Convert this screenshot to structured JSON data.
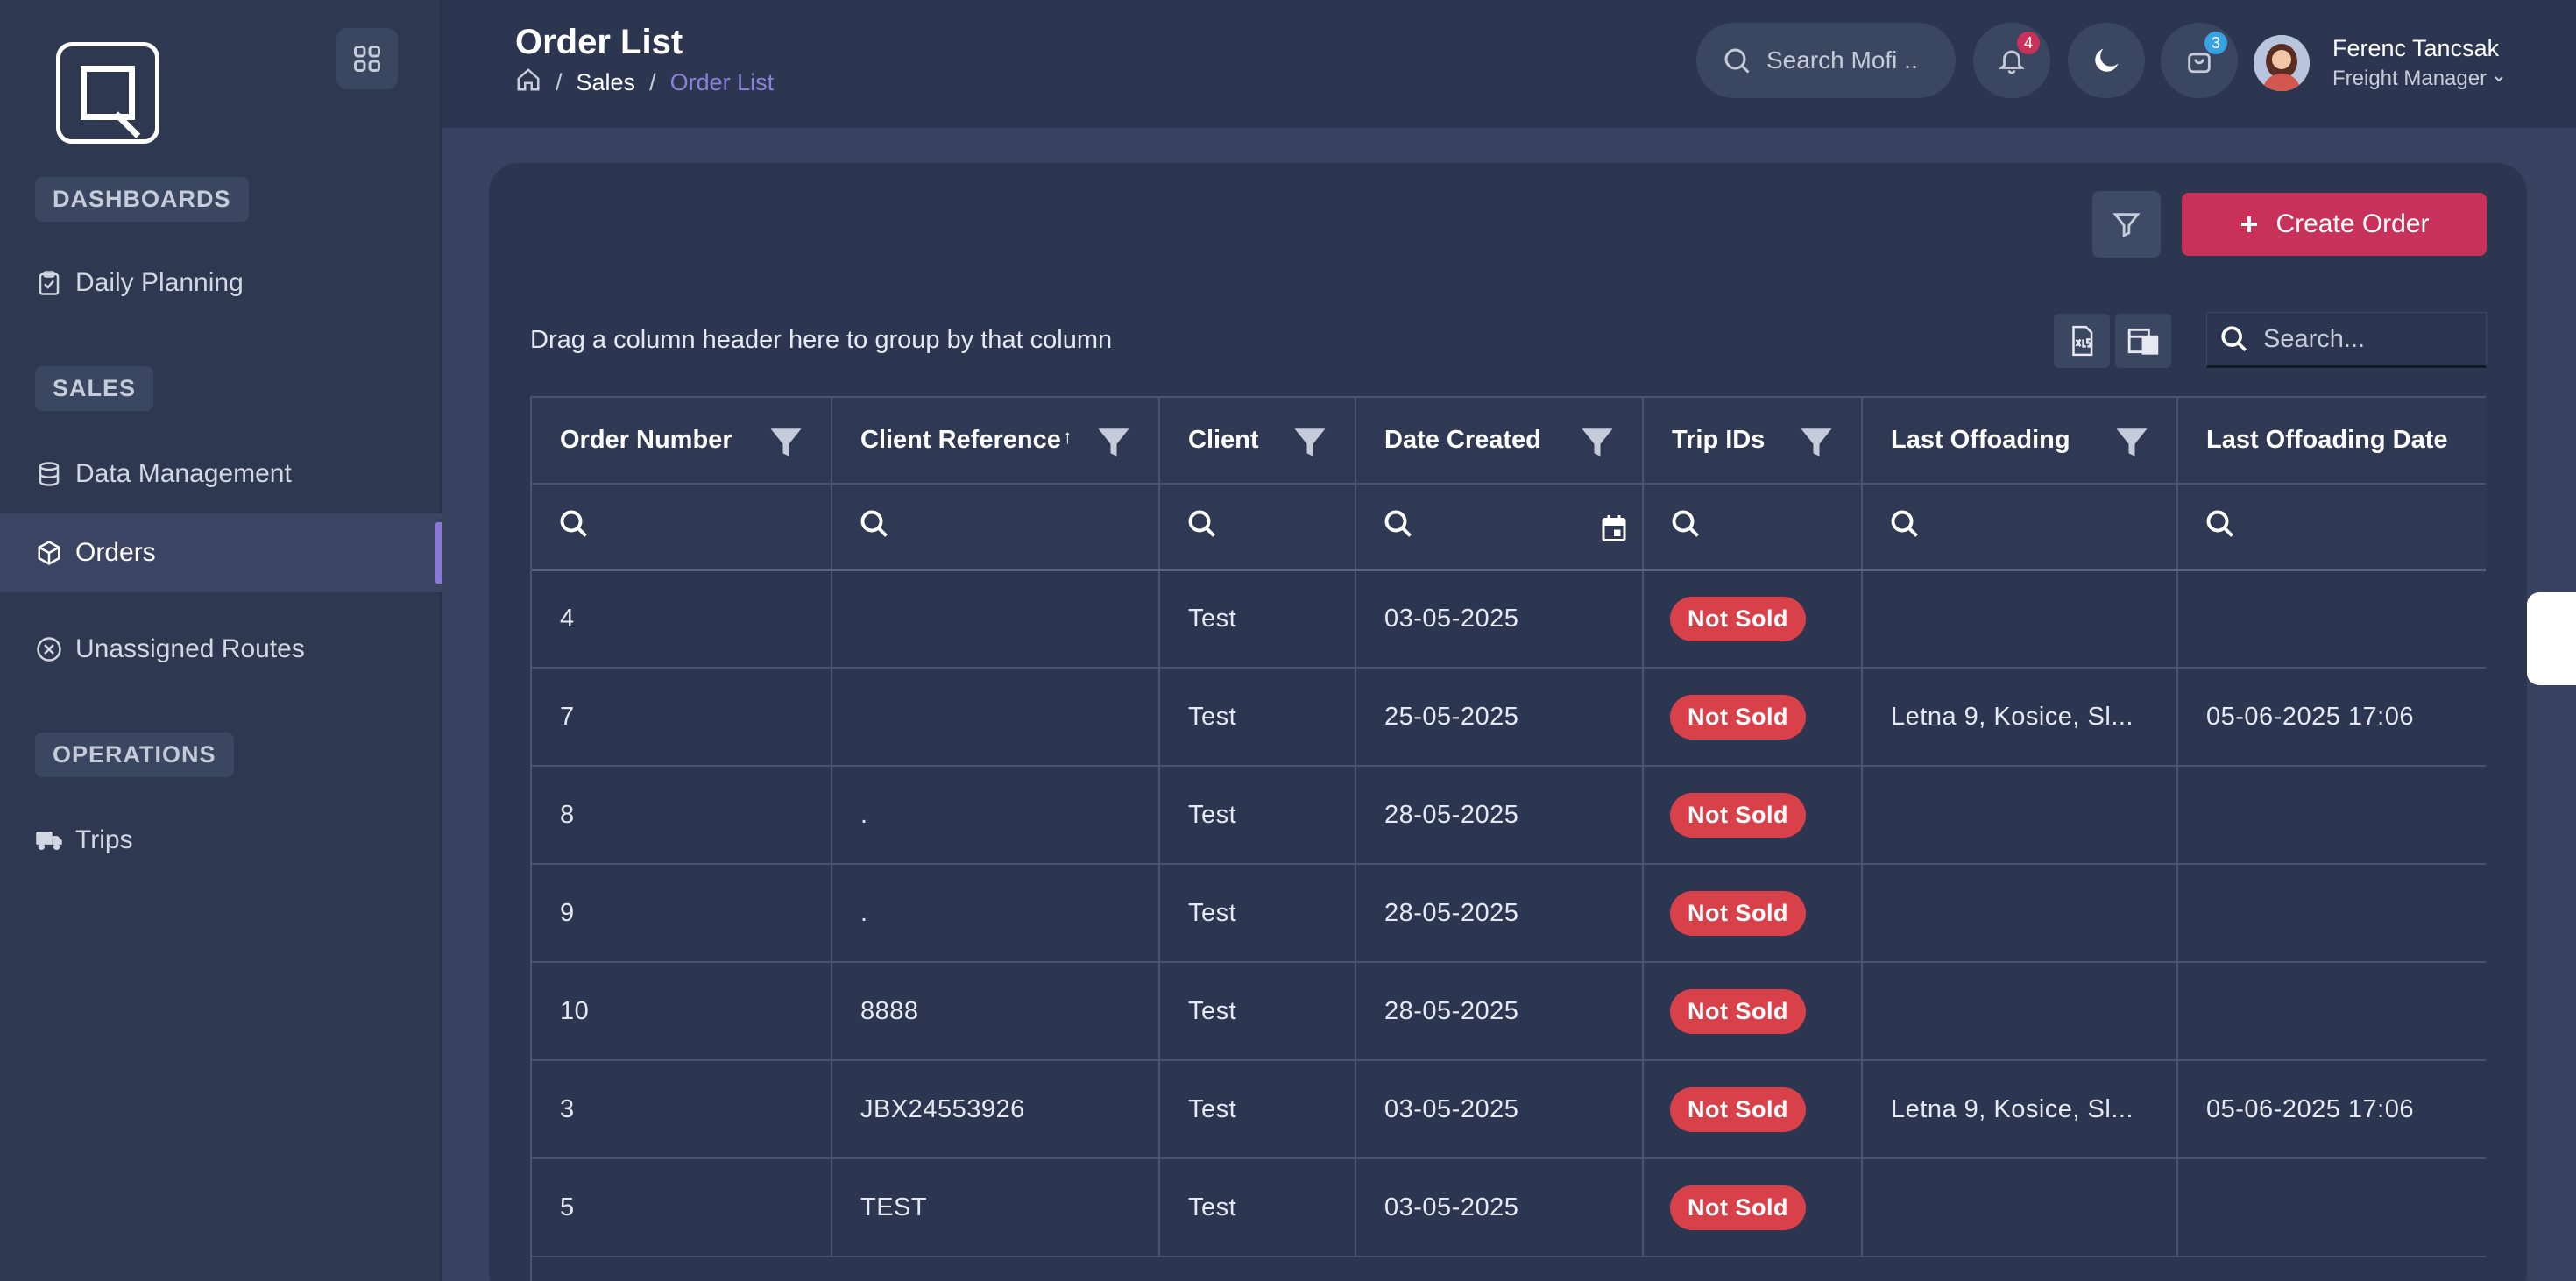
{
  "sidebar": {
    "sections": {
      "dashboards": "DASHBOARDS",
      "sales": "SALES",
      "operations": "OPERATIONS"
    },
    "items": [
      {
        "label": "Daily Planning",
        "icon": "clipboard-check-icon"
      },
      {
        "label": "Data Management",
        "icon": "database-icon"
      },
      {
        "label": "Orders",
        "icon": "box-icon",
        "active": true
      },
      {
        "label": "Unassigned Routes",
        "icon": "x-circle-icon"
      },
      {
        "label": "Trips",
        "icon": "truck-icon"
      }
    ]
  },
  "header": {
    "title": "Order List",
    "breadcrumb": [
      "Sales",
      "Order List"
    ],
    "search_placeholder": "Search Mofi ..",
    "notifications_count": "4",
    "cart_count": "3",
    "user": {
      "name": "Ferenc Tancsak",
      "role": "Freight Manager"
    }
  },
  "toolbar": {
    "create_label": "Create Order",
    "group_hint": "Drag a column header here to group by that column",
    "grid_search_placeholder": "Search..."
  },
  "table": {
    "columns": [
      "Order Number",
      "Client Reference",
      "Client",
      "Date Created",
      "Trip IDs",
      "Last Offoading",
      "Last Offoading Date"
    ],
    "rows": [
      {
        "order": "4",
        "ref": "",
        "client": "Test",
        "date": "03-05-2025",
        "trip": "Not Sold",
        "last": "",
        "last_date": ""
      },
      {
        "order": "7",
        "ref": "",
        "client": "Test",
        "date": "25-05-2025",
        "trip": "Not Sold",
        "last": "Letna 9, Kosice, Sl...",
        "last_date": "05-06-2025 17:06"
      },
      {
        "order": "8",
        "ref": ".",
        "client": "Test",
        "date": "28-05-2025",
        "trip": "Not Sold",
        "last": "",
        "last_date": ""
      },
      {
        "order": "9",
        "ref": ".",
        "client": "Test",
        "date": "28-05-2025",
        "trip": "Not Sold",
        "last": "",
        "last_date": ""
      },
      {
        "order": "10",
        "ref": "8888",
        "client": "Test",
        "date": "28-05-2025",
        "trip": "Not Sold",
        "last": "",
        "last_date": ""
      },
      {
        "order": "3",
        "ref": "JBX24553926",
        "client": "Test",
        "date": "03-05-2025",
        "trip": "Not Sold",
        "last": "Letna 9, Kosice, Sl...",
        "last_date": "05-06-2025 17:06"
      },
      {
        "order": "5",
        "ref": "TEST",
        "client": "Test",
        "date": "03-05-2025",
        "trip": "Not Sold",
        "last": "",
        "last_date": ""
      }
    ]
  },
  "colors": {
    "accent": "#c8325a",
    "status_red": "#d9414a",
    "breadcrumb_active": "#8a80d8",
    "background": "#2c3650"
  }
}
